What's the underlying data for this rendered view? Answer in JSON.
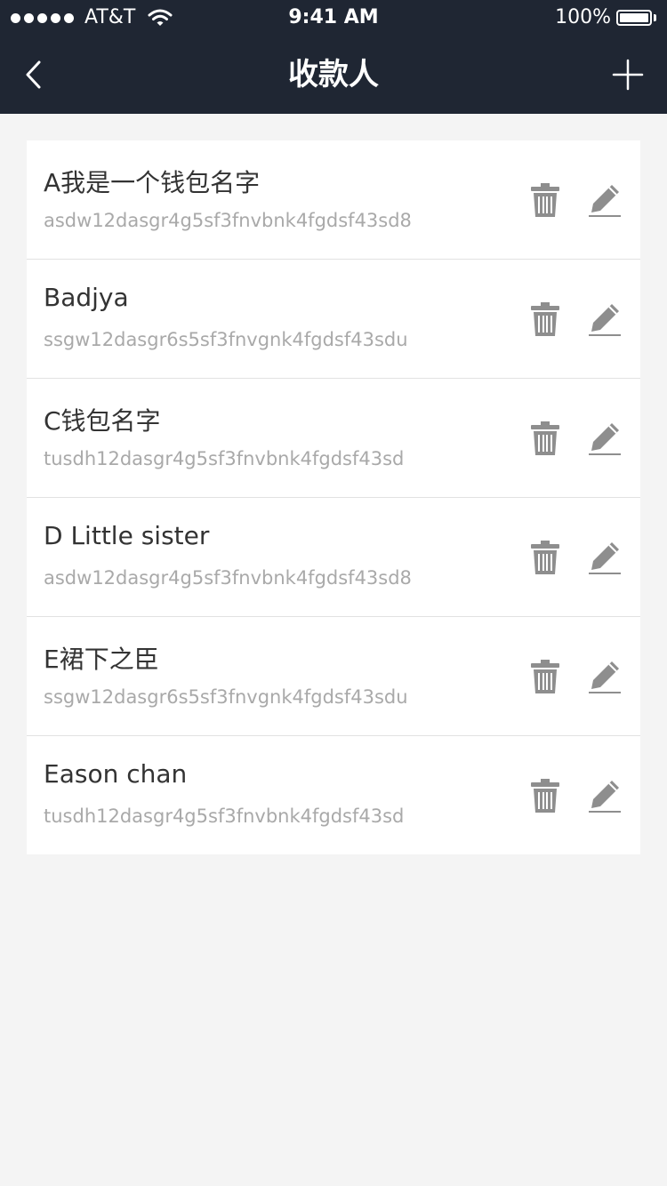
{
  "status_bar": {
    "carrier": "AT&T",
    "time": "9:41 AM",
    "battery": "100%",
    "battery_level": 1.0
  },
  "nav": {
    "back_icon": "chevron-left-icon",
    "title": "收款人",
    "add_icon": "plus-icon"
  },
  "payees": [
    {
      "name": "A我是一个钱包名字",
      "address": "asdw12dasgr4g5sf3fnvbnk4fgdsf43sd8"
    },
    {
      "name": "Badjya",
      "address": "ssgw12dasgr6s5sf3fnvgnk4fgdsf43sdu"
    },
    {
      "name": "C钱包名字",
      "address": "tusdh12dasgr4g5sf3fnvbnk4fgdsf43sd"
    },
    {
      "name": "D Little sister",
      "address": "asdw12dasgr4g5sf3fnvbnk4fgdsf43sd8"
    },
    {
      "name": "E裙下之臣",
      "address": "ssgw12dasgr6s5sf3fnvgnk4fgdsf43sdu"
    },
    {
      "name": "Eason chan",
      "address": "tusdh12dasgr4g5sf3fnvbnk4fgdsf43sd"
    }
  ],
  "row_icons": {
    "delete": "trash-icon",
    "edit": "pencil-icon"
  },
  "colors": {
    "header_bg": "#1f2633",
    "page_bg": "#f4f4f4",
    "icon_gray": "#8e8e8e"
  }
}
